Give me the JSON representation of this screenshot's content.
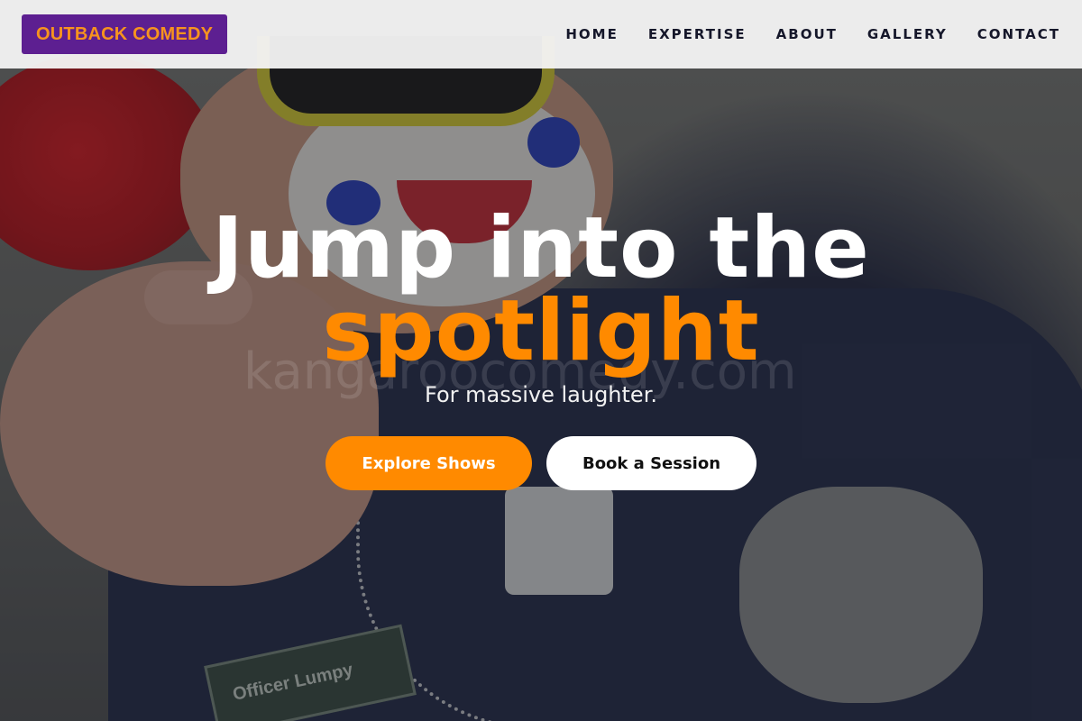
{
  "brand": {
    "logo_text": "OUTBACK COMEDY",
    "primary_color": "#5d1f91",
    "accent_color": "#ff8a00"
  },
  "nav": {
    "items": [
      {
        "label": "HOME"
      },
      {
        "label": "EXPERTISE"
      },
      {
        "label": "ABOUT"
      },
      {
        "label": "GALLERY"
      },
      {
        "label": "CONTACT"
      }
    ]
  },
  "hero": {
    "headline_line1": "Jump into the",
    "headline_line2": "spotlight",
    "subtitle": "For massive laughter.",
    "primary_cta": "Explore Shows",
    "secondary_cta": "Book a Session",
    "watermark": "kangaroocomedy.com",
    "nameplate": "Officer Lumpy"
  }
}
